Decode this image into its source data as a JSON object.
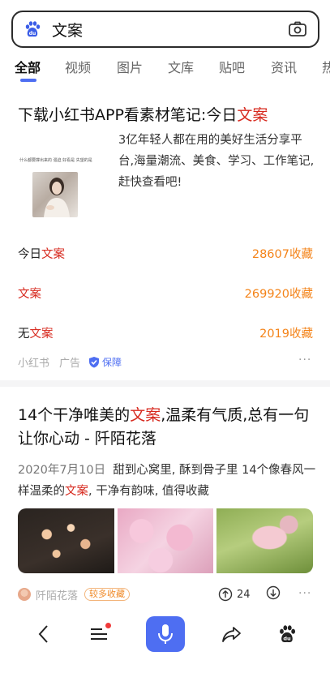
{
  "search": {
    "query": "文案"
  },
  "tabs": [
    "全部",
    "视频",
    "图片",
    "文库",
    "贴吧",
    "资讯",
    "热"
  ],
  "result1": {
    "title_prefix": "下载小红书APP看素材笔记:今日",
    "title_highlight": "文案",
    "thumb_caption": "什么都要撑出来的 强迫 好看是 失望的是",
    "description": "3亿年轻人都在用的美好生活分享平台,海量潮流、美食、学习、工作笔记,赶快查看吧!",
    "rows": [
      {
        "prefix": "今日",
        "highlight": "文案",
        "count": "28607收藏"
      },
      {
        "prefix": "",
        "highlight": "文案",
        "count": "269920收藏"
      },
      {
        "prefix": "无",
        "highlight": "文案",
        "count": "2019收藏"
      }
    ],
    "source": "小红书",
    "ad_label": "广告",
    "guarantee": "保障"
  },
  "result2": {
    "title_prefix": "14个干净唯美的",
    "title_highlight": "文案",
    "title_suffix": ",温柔有气质,总有一句让你心动 - 阡陌花落",
    "date": "2020年7月10日",
    "snippet_a": "甜到心窝里, 酥到骨子里 14个像春风一样温柔的",
    "snippet_highlight": "文案",
    "snippet_b": ", 干净有韵味, 值得收藏",
    "author": "阡陌花落",
    "badge": "较多收藏",
    "share_count": "24"
  },
  "more_label": "···",
  "colors": {
    "highlight": "#d72a1f",
    "count": "#f48318",
    "accent": "#4e6ef2"
  }
}
